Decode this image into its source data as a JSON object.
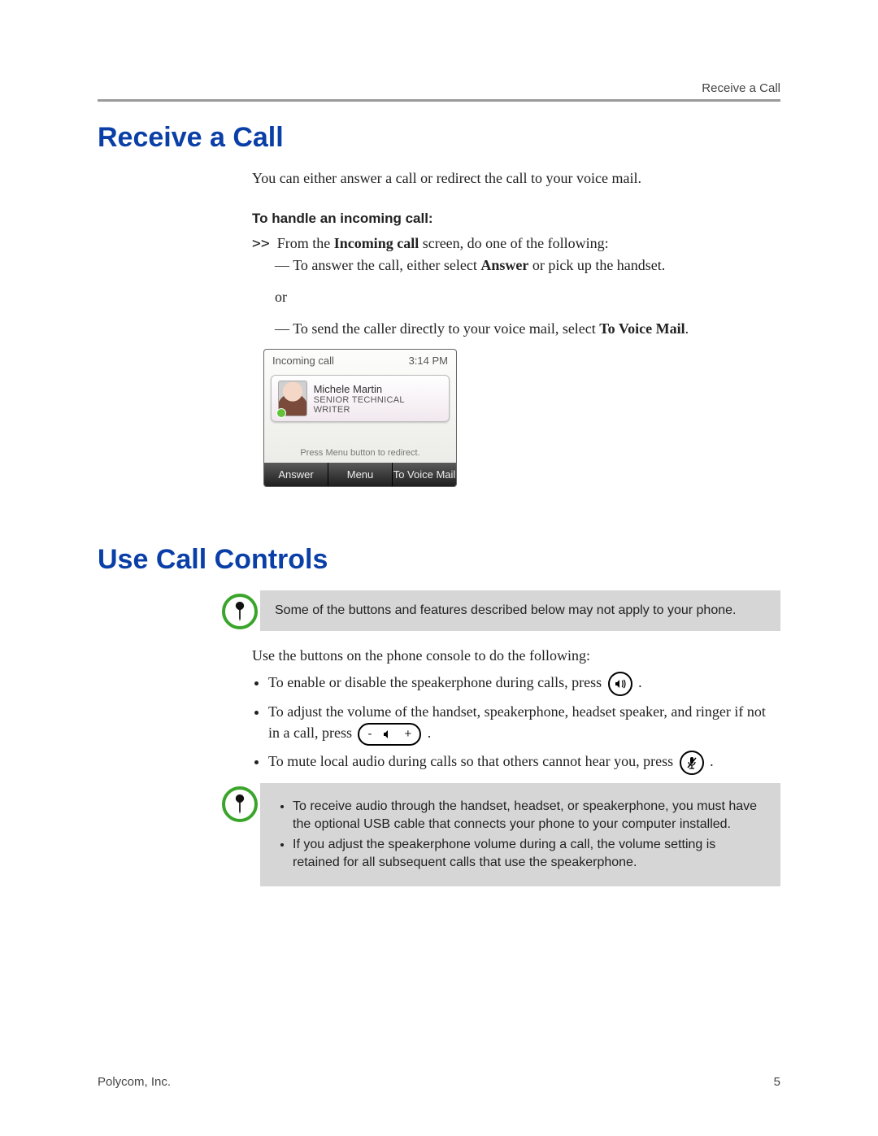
{
  "header": {
    "running": "Receive a Call"
  },
  "section1": {
    "title": "Receive a Call",
    "intro": "You can either answer a call or redirect the call to your voice mail.",
    "subhead": "To handle an incoming call:",
    "step_lead": ">>",
    "step_pre": "From the ",
    "step_bold": "Incoming call",
    "step_post": " screen, do one of the following:",
    "opt1_pre": "To answer the call, either select ",
    "opt1_bold": "Answer",
    "opt1_post": " or pick up the handset.",
    "or": "or",
    "opt2_pre": "To send the caller directly to your voice mail, select ",
    "opt2_bold": "To Voice Mail",
    "opt2_post": "."
  },
  "phone": {
    "title": "Incoming call",
    "time": "3:14 PM",
    "caller_name": "Michele Martin",
    "caller_title": "SENIOR TECHNICAL WRITER",
    "hint": "Press Menu button to redirect.",
    "soft1": "Answer",
    "soft2": "Menu",
    "soft3": "To Voice Mail"
  },
  "section2": {
    "title": "Use Call Controls",
    "note1": "Some of the buttons and features described below may not apply to your phone.",
    "intro": "Use the buttons on the phone console to do the following:",
    "b1_pre": "To enable or disable the speakerphone during calls, press ",
    "b1_post": ".",
    "b2_pre": "To adjust the volume of the handset, speakerphone, headset speaker, and ringer if not in a call, press ",
    "b2_post": ".",
    "b3_pre": "To mute local audio during calls so that others cannot hear you, press ",
    "b3_post": ".",
    "note2_a": "To receive audio through the handset, headset, or speakerphone, you must have the optional USB cable that connects your phone to your computer installed.",
    "note2_b": "If you adjust the speakerphone volume during a call, the volume setting is retained for all subsequent calls that use the speakerphone."
  },
  "volume": {
    "minus": "-",
    "plus": "+"
  },
  "footer": {
    "left": "Polycom, Inc.",
    "right": "5"
  }
}
